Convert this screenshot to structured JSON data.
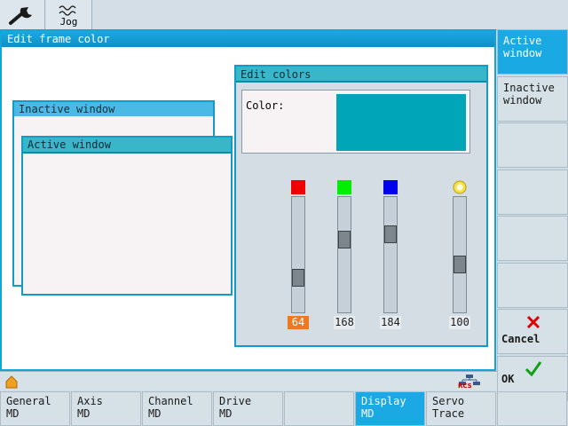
{
  "topbar": {
    "tools_icon": "wrench-icon",
    "jog_label": "Jog"
  },
  "dialog": {
    "title": "Edit frame color",
    "inactive_window_label": "Inactive window",
    "active_window_label": "Active window"
  },
  "edit_colors": {
    "title": "Edit colors",
    "color_label": "Color:",
    "preview_color": "#00a5b8",
    "sliders": [
      {
        "channel": "red",
        "swatch": "#ee0000",
        "value": "64",
        "level": 64,
        "highlight": true
      },
      {
        "channel": "green",
        "swatch": "#00ee00",
        "value": "168",
        "level": 168,
        "highlight": false
      },
      {
        "channel": "blue",
        "swatch": "#0000ee",
        "value": "184",
        "level": 184,
        "highlight": false
      },
      {
        "channel": "brightness",
        "swatch": "#e0d000",
        "value": "100",
        "level": 100,
        "highlight": false
      }
    ]
  },
  "right_softkeys": [
    {
      "label1": "Active",
      "label2": "window",
      "active": true
    },
    {
      "label1": "Inactive",
      "label2": "window",
      "active": false
    },
    {
      "label1": "",
      "label2": "",
      "active": false
    },
    {
      "label1": "",
      "label2": "",
      "active": false
    },
    {
      "label1": "",
      "label2": "",
      "active": false
    },
    {
      "label1": "",
      "label2": "",
      "active": false
    },
    {
      "label1": "Cancel",
      "label2": "",
      "active": false,
      "icon": "cancel-x-icon"
    },
    {
      "label1": "OK",
      "label2": "",
      "active": false,
      "icon": "checkmark-icon"
    }
  ],
  "bottom_softkeys": [
    {
      "label1": "General",
      "label2": "MD",
      "active": false
    },
    {
      "label1": "Axis",
      "label2": "MD",
      "active": false
    },
    {
      "label1": "Channel",
      "label2": "MD",
      "active": false
    },
    {
      "label1": "Drive",
      "label2": "MD",
      "active": false
    },
    {
      "label1": "",
      "label2": "",
      "active": false
    },
    {
      "label1": "Display",
      "label2": "MD",
      "active": true
    },
    {
      "label1": "Servo",
      "label2": "Trace",
      "active": false
    },
    {
      "label1": "",
      "label2": "",
      "active": false
    }
  ],
  "statusbar": {
    "rcs_label": "RCS"
  },
  "colors": {
    "accent": "#1aa9e2",
    "frame": "#139bc8"
  }
}
